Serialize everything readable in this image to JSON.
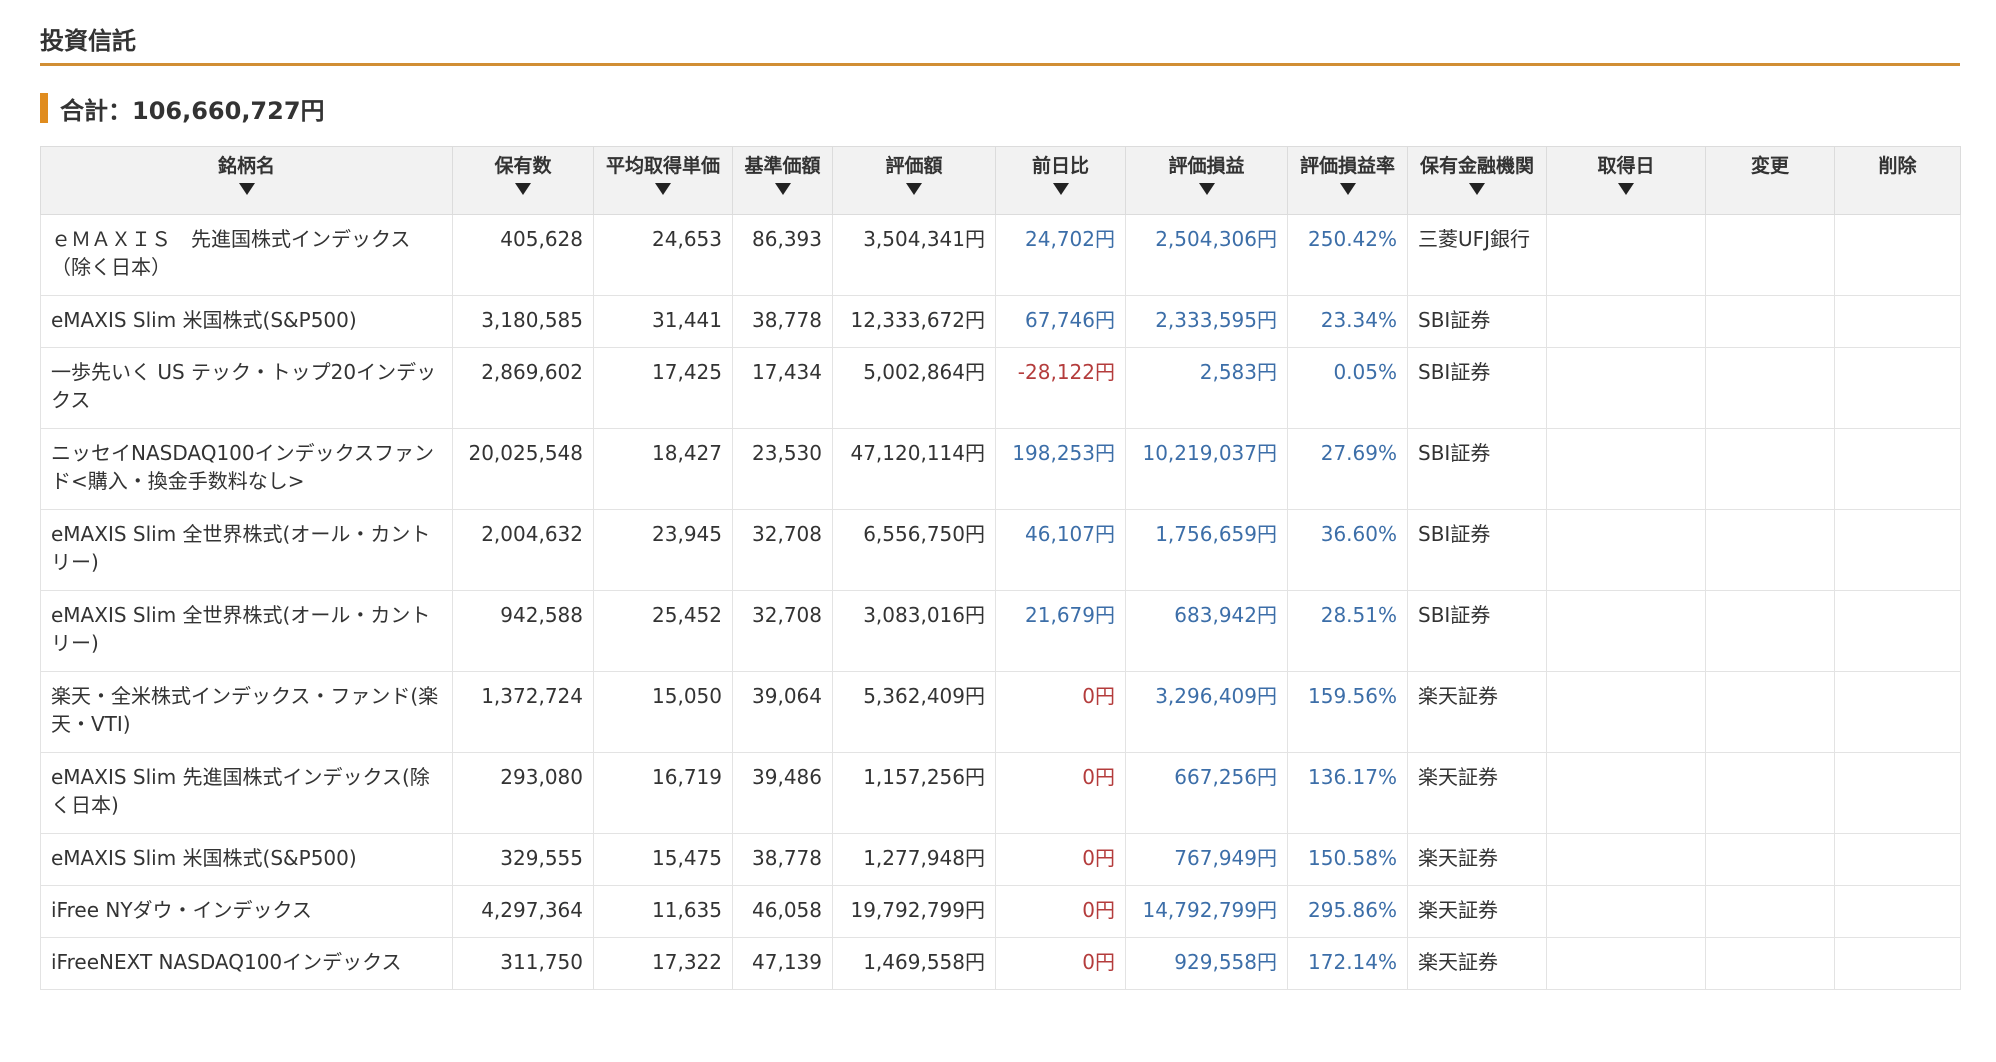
{
  "section_title": "投資信託",
  "total": {
    "label": "合計：",
    "value": "106,660,727円"
  },
  "table": {
    "headers": {
      "name": "銘柄名",
      "quantity": "保有数",
      "avg_cost": "平均取得単価",
      "base_price": "基準価額",
      "valuation": "評価額",
      "day_change": "前日比",
      "pnl": "評価損益",
      "pnl_rate": "評価損益率",
      "institution": "保有金融機関",
      "acquired_date": "取得日",
      "edit": "変更",
      "delete": "削除"
    },
    "rows": [
      {
        "name": "ｅＭＡＸＩＳ　先進国株式インデックス（除く日本）",
        "quantity": "405,628",
        "avg_cost": "24,653",
        "base_price": "86,393",
        "valuation": "3,504,341円",
        "day_change": "24,702円",
        "pnl": "2,504,306円",
        "pnl_rate": "250.42%",
        "institution": "三菱UFJ銀行",
        "acquired_date": "",
        "day_sign": "pos",
        "tall": true
      },
      {
        "name": "eMAXIS Slim 米国株式(S&P500)",
        "quantity": "3,180,585",
        "avg_cost": "31,441",
        "base_price": "38,778",
        "valuation": "12,333,672円",
        "day_change": "67,746円",
        "pnl": "2,333,595円",
        "pnl_rate": "23.34%",
        "institution": "SBI証券",
        "acquired_date": "",
        "day_sign": "pos",
        "tall": false
      },
      {
        "name": "一歩先いく US テック・トップ20インデックス",
        "quantity": "2,869,602",
        "avg_cost": "17,425",
        "base_price": "17,434",
        "valuation": "5,002,864円",
        "day_change": "-28,122円",
        "pnl": "2,583円",
        "pnl_rate": "0.05%",
        "institution": "SBI証券",
        "acquired_date": "",
        "day_sign": "neg",
        "tall": true
      },
      {
        "name": "ニッセイNASDAQ100インデックスファンド<購入・換金手数料なし>",
        "quantity": "20,025,548",
        "avg_cost": "18,427",
        "base_price": "23,530",
        "valuation": "47,120,114円",
        "day_change": "198,253円",
        "pnl": "10,219,037円",
        "pnl_rate": "27.69%",
        "institution": "SBI証券",
        "acquired_date": "",
        "day_sign": "pos",
        "tall": true
      },
      {
        "name": "eMAXIS Slim 全世界株式(オール・カントリー)",
        "quantity": "2,004,632",
        "avg_cost": "23,945",
        "base_price": "32,708",
        "valuation": "6,556,750円",
        "day_change": "46,107円",
        "pnl": "1,756,659円",
        "pnl_rate": "36.60%",
        "institution": "SBI証券",
        "acquired_date": "",
        "day_sign": "pos",
        "tall": true
      },
      {
        "name": "eMAXIS Slim 全世界株式(オール・カントリー)",
        "quantity": "942,588",
        "avg_cost": "25,452",
        "base_price": "32,708",
        "valuation": "3,083,016円",
        "day_change": "21,679円",
        "pnl": "683,942円",
        "pnl_rate": "28.51%",
        "institution": "SBI証券",
        "acquired_date": "",
        "day_sign": "pos",
        "tall": true
      },
      {
        "name": "楽天・全米株式インデックス・ファンド(楽天・VTI)",
        "quantity": "1,372,724",
        "avg_cost": "15,050",
        "base_price": "39,064",
        "valuation": "5,362,409円",
        "day_change": "0円",
        "pnl": "3,296,409円",
        "pnl_rate": "159.56%",
        "institution": "楽天証券",
        "acquired_date": "",
        "day_sign": "zero",
        "tall": true
      },
      {
        "name": "eMAXIS Slim 先進国株式インデックス(除く日本)",
        "quantity": "293,080",
        "avg_cost": "16,719",
        "base_price": "39,486",
        "valuation": "1,157,256円",
        "day_change": "0円",
        "pnl": "667,256円",
        "pnl_rate": "136.17%",
        "institution": "楽天証券",
        "acquired_date": "",
        "day_sign": "zero",
        "tall": true
      },
      {
        "name": "eMAXIS Slim 米国株式(S&P500)",
        "quantity": "329,555",
        "avg_cost": "15,475",
        "base_price": "38,778",
        "valuation": "1,277,948円",
        "day_change": "0円",
        "pnl": "767,949円",
        "pnl_rate": "150.58%",
        "institution": "楽天証券",
        "acquired_date": "",
        "day_sign": "zero",
        "tall": false
      },
      {
        "name": "iFree NYダウ・インデックス",
        "quantity": "4,297,364",
        "avg_cost": "11,635",
        "base_price": "46,058",
        "valuation": "19,792,799円",
        "day_change": "0円",
        "pnl": "14,792,799円",
        "pnl_rate": "295.86%",
        "institution": "楽天証券",
        "acquired_date": "",
        "day_sign": "zero",
        "tall": false
      },
      {
        "name": "iFreeNEXT NASDAQ100インデックス",
        "quantity": "311,750",
        "avg_cost": "17,322",
        "base_price": "47,139",
        "valuation": "1,469,558円",
        "day_change": "0円",
        "pnl": "929,558円",
        "pnl_rate": "172.14%",
        "institution": "楽天証券",
        "acquired_date": "",
        "day_sign": "zero",
        "tall": false
      }
    ]
  }
}
